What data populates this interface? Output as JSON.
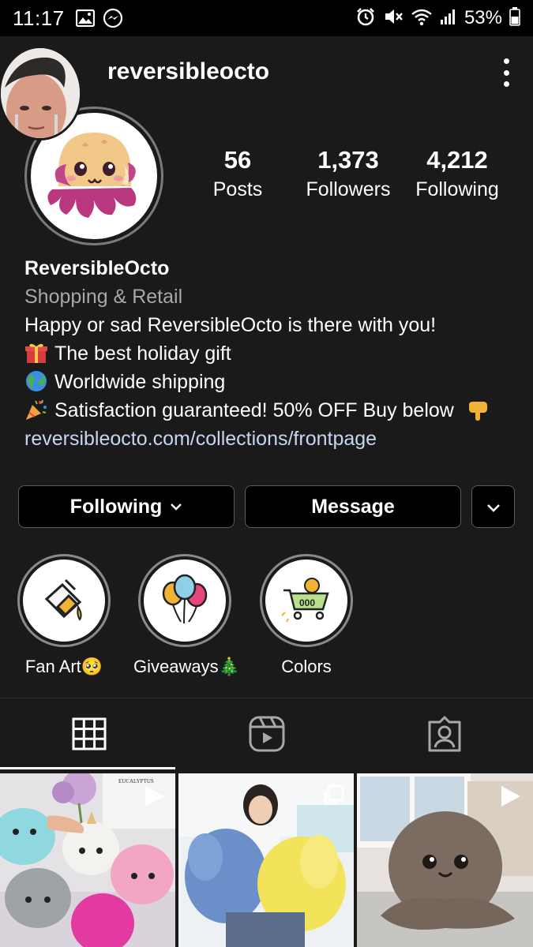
{
  "status_bar": {
    "time": "11:17",
    "battery": "53%",
    "icons": [
      "gallery-icon",
      "messenger-icon",
      "alarm-icon",
      "mute-icon",
      "wifi-icon",
      "signal-icon",
      "battery-icon"
    ]
  },
  "header": {
    "username": "reversibleocto",
    "menu_icon": "more-vertical-icon"
  },
  "stats": [
    {
      "value": "56",
      "label": "Posts"
    },
    {
      "value": "1,373",
      "label": "Followers"
    },
    {
      "value": "4,212",
      "label": "Following"
    }
  ],
  "bio": {
    "name": "ReversibleOcto",
    "category": "Shopping & Retail",
    "lines": [
      "Happy or sad ReversibleOcto is there with you!",
      "The best holiday gift",
      "Worldwide shipping",
      "Satisfaction guaranteed! 50% OFF Buy below"
    ],
    "line_icons": [
      "",
      "gift-icon",
      "globe-icon",
      "party-popper-icon"
    ],
    "link": "reversibleocto.com/collections/frontpage"
  },
  "buttons": {
    "following": "Following",
    "message": "Message"
  },
  "highlights": [
    {
      "label": "Fan Art🥺",
      "icon": "paint-icon"
    },
    {
      "label": "Giveaways🎄",
      "icon": "balloons-icon"
    },
    {
      "label": "Colors",
      "icon": "shopping-cart-icon"
    }
  ],
  "tabs": [
    {
      "icon": "grid-icon",
      "active": true
    },
    {
      "icon": "reels-icon",
      "active": false
    },
    {
      "icon": "tagged-icon",
      "active": false
    }
  ],
  "posts": [
    {
      "type": "reel",
      "caption": "EUCALYPTUS"
    },
    {
      "type": "carousel",
      "caption": ""
    },
    {
      "type": "reel",
      "caption": ""
    }
  ],
  "colors": {
    "background": "#1a1a1a",
    "link": "#c7d6f0",
    "muted": "#a8a8a8"
  }
}
